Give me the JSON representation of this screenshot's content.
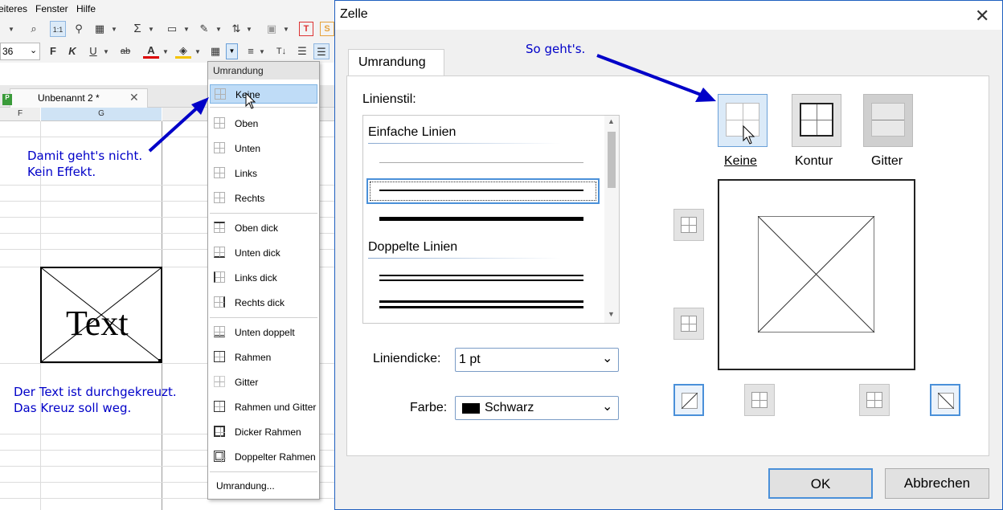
{
  "app": {
    "menu": [
      "eiteres",
      "Fenster",
      "Hilfe"
    ],
    "font_size_value": "36",
    "format_buttons": [
      "F",
      "K",
      "U",
      "ab"
    ],
    "sheet_tab": "Unbenannt 2 *",
    "columns": [
      "F",
      "G"
    ],
    "cell_text": "Text"
  },
  "annotations": {
    "left_note_1": "Damit geht's nicht.",
    "left_note_2": "Kein Effekt.",
    "bottom_note_1": "Der Text ist durchgekreuzt.",
    "bottom_note_2": "Das Kreuz soll weg.",
    "dialog_note": "So geht's."
  },
  "border_menu": {
    "header": "Umrandung",
    "items": [
      {
        "label": "Keine",
        "highlighted": true
      },
      {
        "label": "Oben"
      },
      {
        "label": "Unten"
      },
      {
        "label": "Links"
      },
      {
        "label": "Rechts"
      },
      {
        "label": "Oben dick"
      },
      {
        "label": "Unten dick"
      },
      {
        "label": "Links dick"
      },
      {
        "label": "Rechts dick"
      },
      {
        "label": "Unten doppelt"
      },
      {
        "label": "Rahmen"
      },
      {
        "label": "Gitter"
      },
      {
        "label": "Rahmen und Gitter"
      },
      {
        "label": "Dicker Rahmen"
      },
      {
        "label": "Doppelter Rahmen"
      },
      {
        "label": "Umrandung..."
      }
    ]
  },
  "dialog": {
    "title": "Zelle",
    "tab": "Umrandung",
    "line_style_label": "Linienstil:",
    "line_groups": [
      "Einfache Linien",
      "Doppelte Linien"
    ],
    "line_width_label": "Liniendicke:",
    "line_width_value": "1 pt",
    "color_label": "Farbe:",
    "color_value": "Schwarz",
    "color_swatch": "#000000",
    "presets": [
      "Keine",
      "Kontur",
      "Gitter"
    ],
    "ok": "OK",
    "cancel": "Abbrechen"
  },
  "colors": {
    "annotation_blue": "#0000c8",
    "highlight": "#bfdcf7",
    "dialog_border": "#1f5fbf"
  }
}
